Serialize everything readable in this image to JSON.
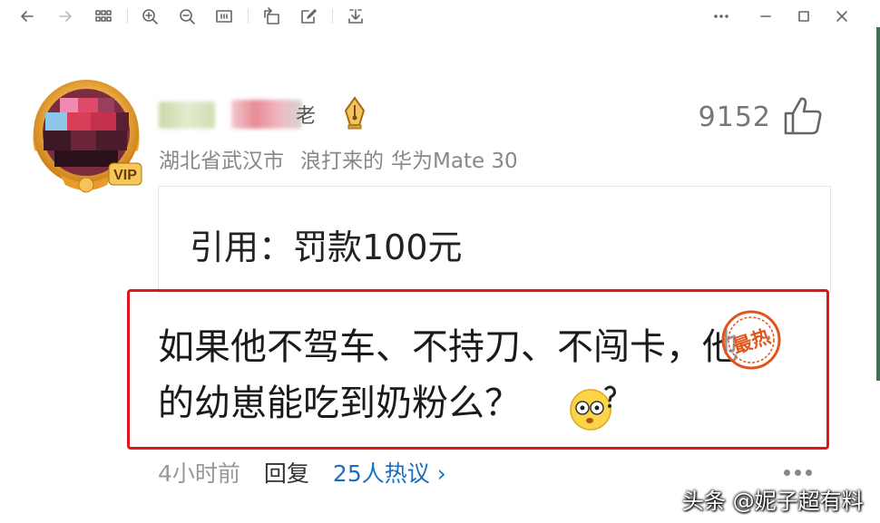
{
  "toolbar": {
    "icons": [
      "back-icon",
      "forward-icon",
      "apps-grid-icon",
      "zoom-in-icon",
      "zoom-out-icon",
      "fit-screen-icon",
      "rotate-icon",
      "edit-icon",
      "download-icon",
      "more-icon",
      "minimize-icon",
      "maximize-icon",
      "close-icon"
    ]
  },
  "post": {
    "username_suffix": "老",
    "location": "湖北省武汉市",
    "source": "浪打来的",
    "device": "华为Mate 30",
    "likes": "9152",
    "vip_label": "VIP",
    "quote": "引用：罚款100元",
    "comment_line1": "如果他不驾车、不持刀、不闯卡，他",
    "comment_line2": "的幼崽能吃到奶粉么？",
    "hot_stamp": "最热",
    "time": "4小时前",
    "reply_label": "回复",
    "discussion": "25人热议",
    "discussion_arrow": "›"
  },
  "watermark": "头条 @妮子超有料",
  "colors": {
    "highlight": "#e0161f",
    "link": "#1a6fbf",
    "stamp": "#e0551c"
  }
}
